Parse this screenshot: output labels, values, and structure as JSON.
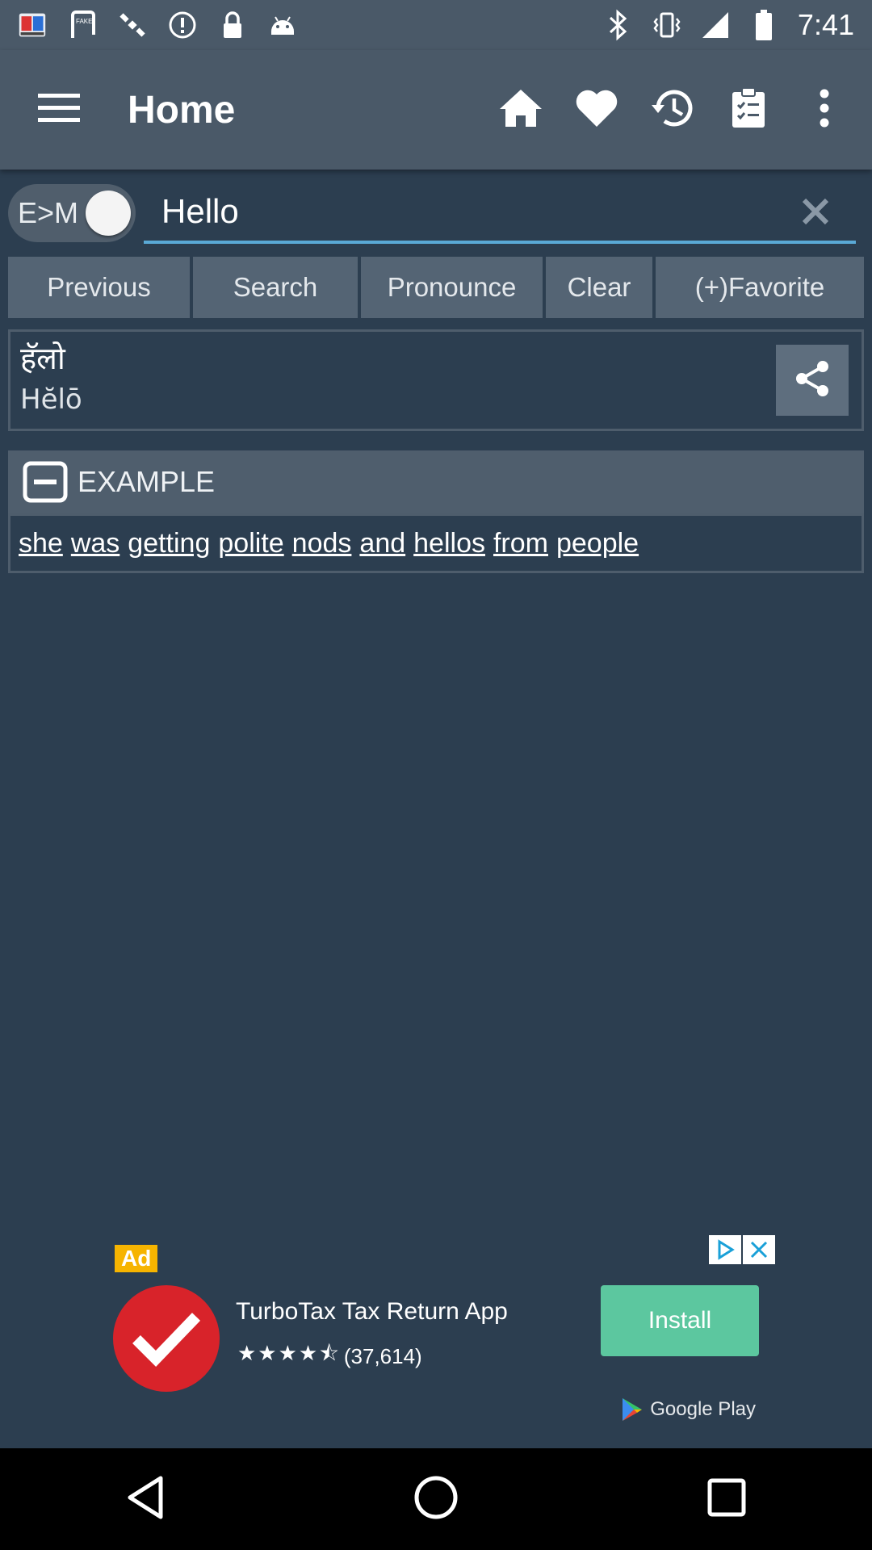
{
  "status_bar": {
    "time": "7:41",
    "left_icons": [
      "dictionary-app-icon",
      "fake-gps-icon",
      "satellite-icon",
      "alert-icon",
      "lock-icon",
      "android-icon"
    ],
    "right_icons": [
      "bluetooth-icon",
      "vibrate-icon",
      "signal-icon",
      "battery-icon"
    ]
  },
  "app_bar": {
    "title": "Home",
    "actions": [
      "home-icon",
      "favorite-heart-icon",
      "history-icon",
      "clipboard-icon",
      "more-vert-icon"
    ]
  },
  "search": {
    "toggle_label": "E>M",
    "value": "Hello",
    "placeholder": ""
  },
  "buttons": {
    "previous": "Previous",
    "search": "Search",
    "pronounce": "Pronounce",
    "clear": "Clear",
    "favorite": "(+)Favorite"
  },
  "result": {
    "word": "हॅलो",
    "transliteration": "Hĕlō"
  },
  "example": {
    "title": "EXAMPLE",
    "words": [
      "she",
      "was",
      "getting",
      "polite",
      "nods",
      "and",
      "hellos",
      "from",
      "people"
    ]
  },
  "ad": {
    "label": "Ad",
    "app_name": "TurboTax Tax Return App",
    "stars": "★★★★⯪",
    "reviews": "(37,614)",
    "install_label": "Install",
    "store_label": "Google Play"
  },
  "colors": {
    "background": "#2c3e50",
    "toolbar": "#4a5968",
    "button": "#546474",
    "accent_underline": "#5aa9d6",
    "install_green": "#5cc79f",
    "ad_logo_red": "#d8232a"
  }
}
